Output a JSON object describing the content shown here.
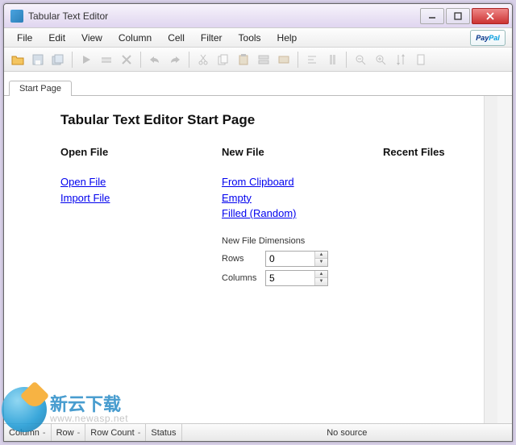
{
  "window": {
    "title": "Tabular Text Editor"
  },
  "menu": {
    "file": "File",
    "edit": "Edit",
    "view": "View",
    "column": "Column",
    "cell": "Cell",
    "filter": "Filter",
    "tools": "Tools",
    "help": "Help"
  },
  "paypal": {
    "pay": "Pay",
    "pal": "Pal"
  },
  "tabs": {
    "start": "Start Page"
  },
  "page": {
    "title": "Tabular Text Editor Start Page",
    "open_heading": "Open File",
    "new_heading": "New File",
    "recent_heading": "Recent Files",
    "open_file": "Open File",
    "import_file": "Import File",
    "from_clipboard": "From Clipboard",
    "empty": "Empty",
    "filled_random": "Filled (Random)",
    "dims_label": "New File Dimensions",
    "rows_label": "Rows",
    "cols_label": "Columns",
    "rows_value": "0",
    "cols_value": "5"
  },
  "status": {
    "column": "Column",
    "row": "Row",
    "rowcount": "Row Count",
    "status": "Status",
    "dash": "-",
    "source": "No source"
  },
  "watermark": {
    "cn": "新云下载",
    "url": "www.newasp.net"
  }
}
